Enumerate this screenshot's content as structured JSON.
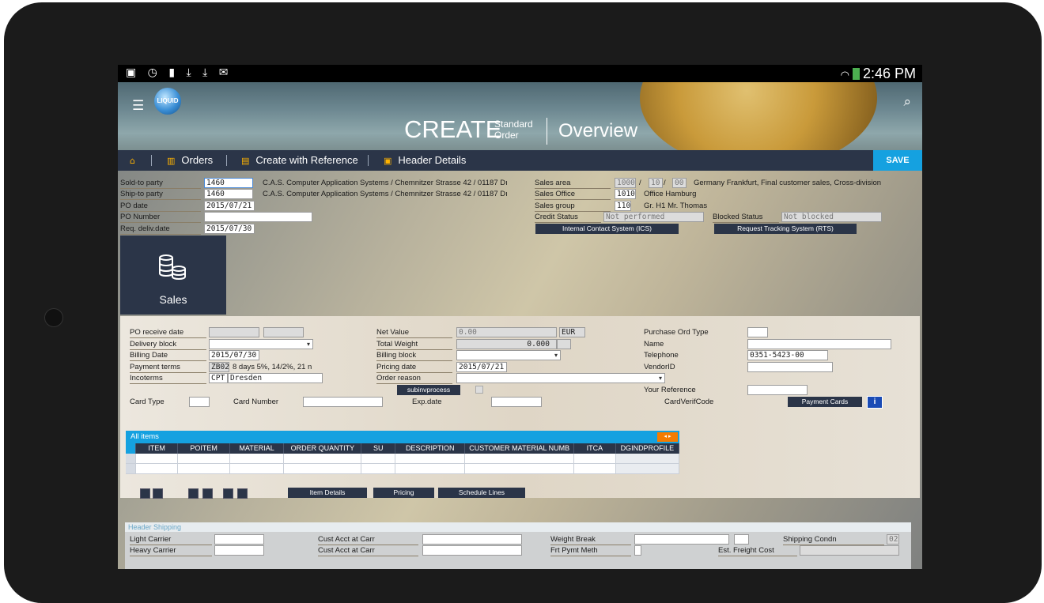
{
  "statusbar": {
    "icons": "▣ ◷ ▮ ⤓ ⤓ ✉",
    "time": "2:46 PM"
  },
  "app": {
    "logo_text": "LIQUID"
  },
  "hero": {
    "create": "CREATE",
    "sub_top": "Standard",
    "sub_bottom": "Order",
    "overview": "Overview"
  },
  "nav": {
    "orders": "Orders",
    "create_ref": "Create with Reference",
    "header_details": "Header Details",
    "save": "SAVE"
  },
  "header": {
    "sold_to_label": "Sold-to party",
    "sold_to_value": "1460",
    "sold_to_text": "C.A.S. Computer Application Systems / Chemnitzer Strasse 42 / 01187 Dı",
    "ship_to_label": "Ship-to party",
    "ship_to_value": "1460",
    "ship_to_text": "C.A.S. Computer Application Systems / Chemnitzer Strasse 42 / 01187 Dı",
    "po_date_label": "PO date",
    "po_date_value": "2015/07/21",
    "po_number_label": "PO Number",
    "po_number_value": "",
    "req_deliv_label": "Req. deliv.date",
    "req_deliv_value": "2015/07/30",
    "sales_area_label": "Sales area",
    "sales_area_1": "1000",
    "sales_area_2": "10",
    "sales_area_3": "00",
    "slash": "/",
    "sales_area_text": "Germany Frankfurt, Final customer sales, Cross-division",
    "sales_office_label": "Sales Office",
    "sales_office_value": "1010",
    "sales_office_text": "Office Hamburg",
    "sales_group_label": "Sales group",
    "sales_group_value": "110",
    "sales_group_text": "Gr. H1 Mr. Thomas",
    "credit_status_label": "Credit Status",
    "credit_status_value": "Not performed",
    "blocked_status_label": "Blocked Status",
    "blocked_status_value": "Not blocked",
    "ics_button": "Internal Contact System (ICS)",
    "rts_button": "Request Tracking System (RTS)"
  },
  "tile": {
    "label": "Sales"
  },
  "sales": {
    "po_receive_label": "PO receive date",
    "delivery_block_label": "Delivery block",
    "billing_date_label": "Billing Date",
    "billing_date_value": "2015/07/30",
    "payment_terms_label": "Payment terms",
    "payment_terms_code": "ZB02",
    "payment_terms_text": "8 days 5%, 14/2%, 21 n",
    "incoterms_label": "Incoterms",
    "incoterms_code": "CPT",
    "incoterms_text": "Dresden",
    "card_type_label": "Card Type",
    "card_number_label": "Card Number",
    "net_value_label": "Net Value",
    "net_value_value": "0.00",
    "currency": "EUR",
    "total_weight_label": "Total Weight",
    "total_weight_value": "0.000",
    "billing_block_label": "Billing block",
    "pricing_date_label": "Pricing date",
    "pricing_date_value": "2015/07/21",
    "order_reason_label": "Order reason",
    "subinvprocess_button": "subinvprocess",
    "exp_date_label": "Exp.date",
    "purchase_ord_type_label": "Purchase Ord Type",
    "name_label": "Name",
    "telephone_label": "Telephone",
    "telephone_value": "0351-5423-00",
    "vendorid_label": "VendorID",
    "your_reference_label": "Your Reference",
    "cardverifcode_label": "CardVerifCode",
    "payment_cards_button": "Payment Cards"
  },
  "items": {
    "title": "All items",
    "arrows": "◂ ▸",
    "columns": [
      "",
      "ITEM",
      "POITEM",
      "MATERIAL",
      "ORDER QUANTITY",
      "SU",
      "DESCRIPTION",
      "CUSTOMER MATERIAL NUMB",
      "ITCA",
      "DGINDPROFILE"
    ],
    "item_details_button": "Item Details",
    "pricing_button": "Pricing",
    "schedule_lines_button": "Schedule Lines"
  },
  "shipping": {
    "title": "Header Shipping",
    "light_carrier_label": "Light Carrier",
    "heavy_carrier_label": "Heavy Carrier",
    "cust_acct_label_1": "Cust Acct at Carr",
    "cust_acct_label_2": "Cust Acct at Carr",
    "weight_break_label": "Weight Break",
    "frt_pymt_label": "Frt Pymt Meth",
    "shipping_condn_label": "Shipping Condn",
    "shipping_condn_value": "02",
    "est_freight_label": "Est. Freight Cost"
  }
}
